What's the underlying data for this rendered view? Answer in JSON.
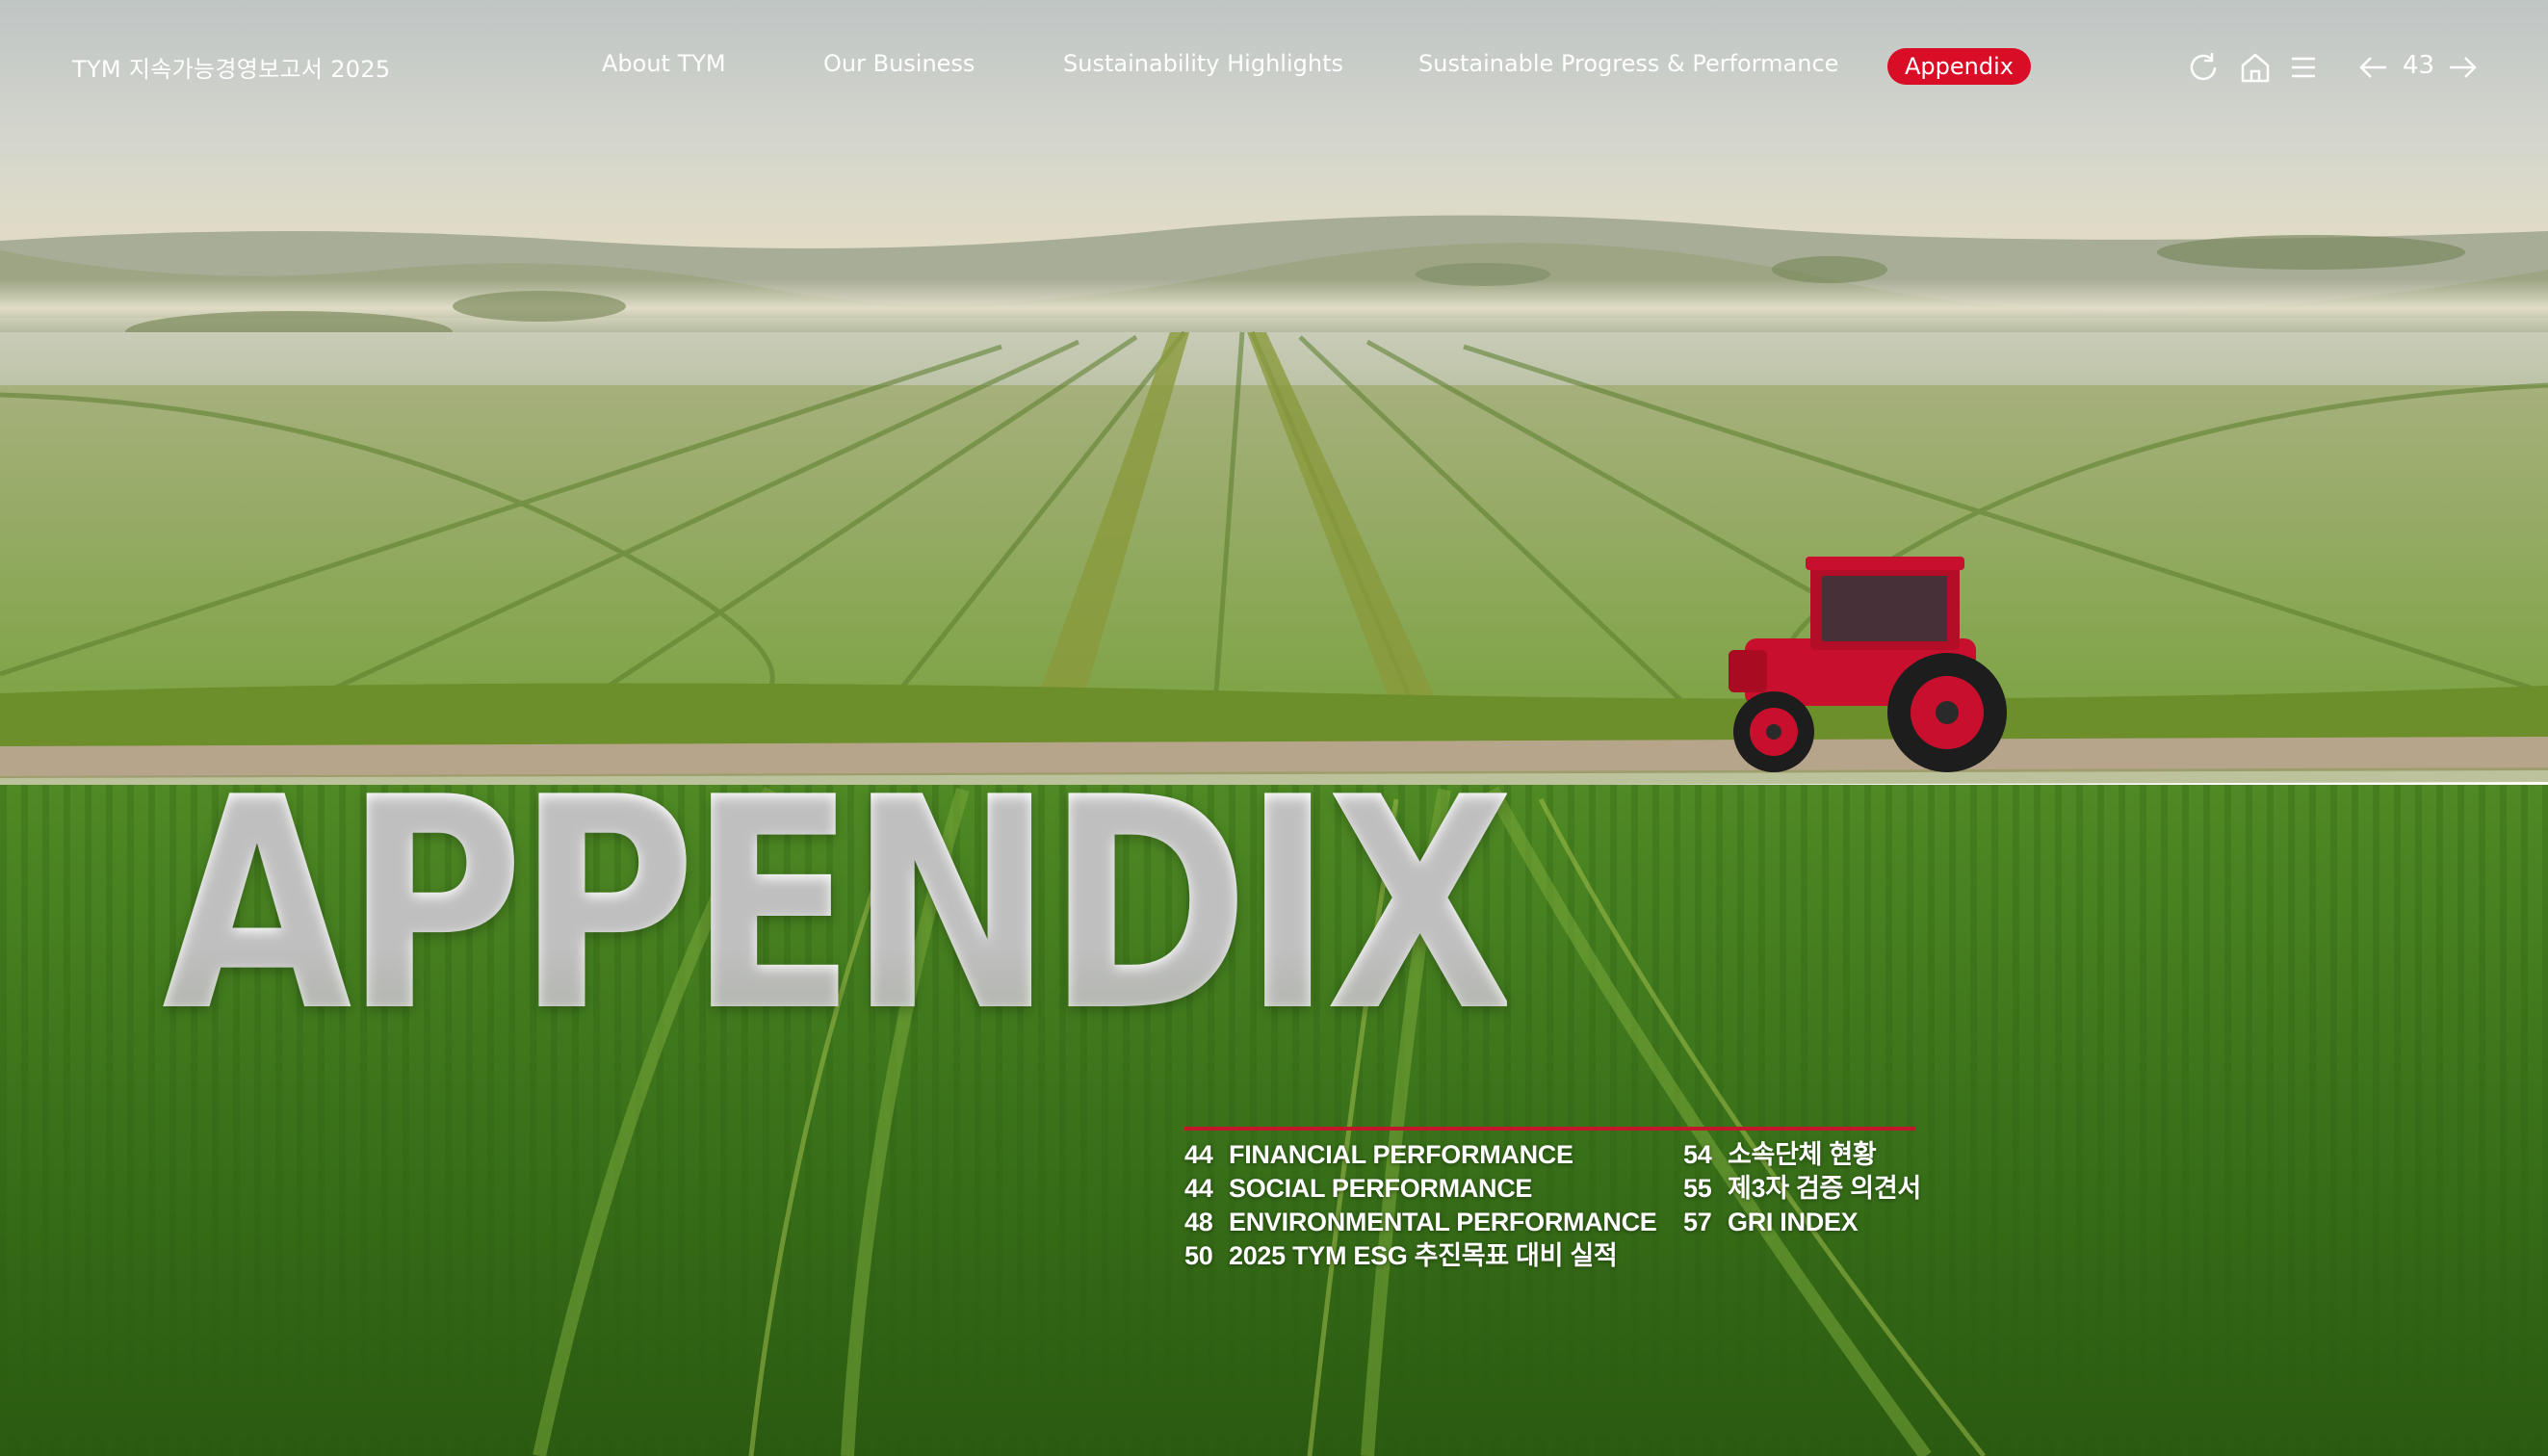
{
  "header": {
    "report_title": "TYM 지속가능경영보고서 2025",
    "nav": [
      {
        "label": "About TYM"
      },
      {
        "label": "Our Business"
      },
      {
        "label": "Sustainability Highlights"
      },
      {
        "label": "Sustainable Progress & Performance"
      }
    ],
    "active_nav": "Appendix",
    "page_number": "43",
    "icons": [
      "refresh-icon",
      "home-icon",
      "menu-icon",
      "arrow-left-icon",
      "arrow-right-icon"
    ]
  },
  "hero": {
    "title": "APPENDIX"
  },
  "toc": {
    "left": [
      {
        "num": "44",
        "label": "FINANCIAL PERFORMANCE"
      },
      {
        "num": "44",
        "label": "SOCIAL PERFORMANCE"
      },
      {
        "num": "48",
        "label": "ENVIRONMENTAL PERFORMANCE"
      },
      {
        "num": "50",
        "label": "2025 TYM ESG 추진목표 대비 실적"
      }
    ],
    "right": [
      {
        "num": "54",
        "label": "소속단체 현황"
      },
      {
        "num": "55",
        "label": "제3자 검증 의견서"
      },
      {
        "num": "57",
        "label": "GRI INDEX"
      }
    ]
  },
  "colors": {
    "accent_red": "#d90d26",
    "text": "#ffffff",
    "field_green": "#3d7a1e",
    "sky": "#c9cfcc"
  }
}
